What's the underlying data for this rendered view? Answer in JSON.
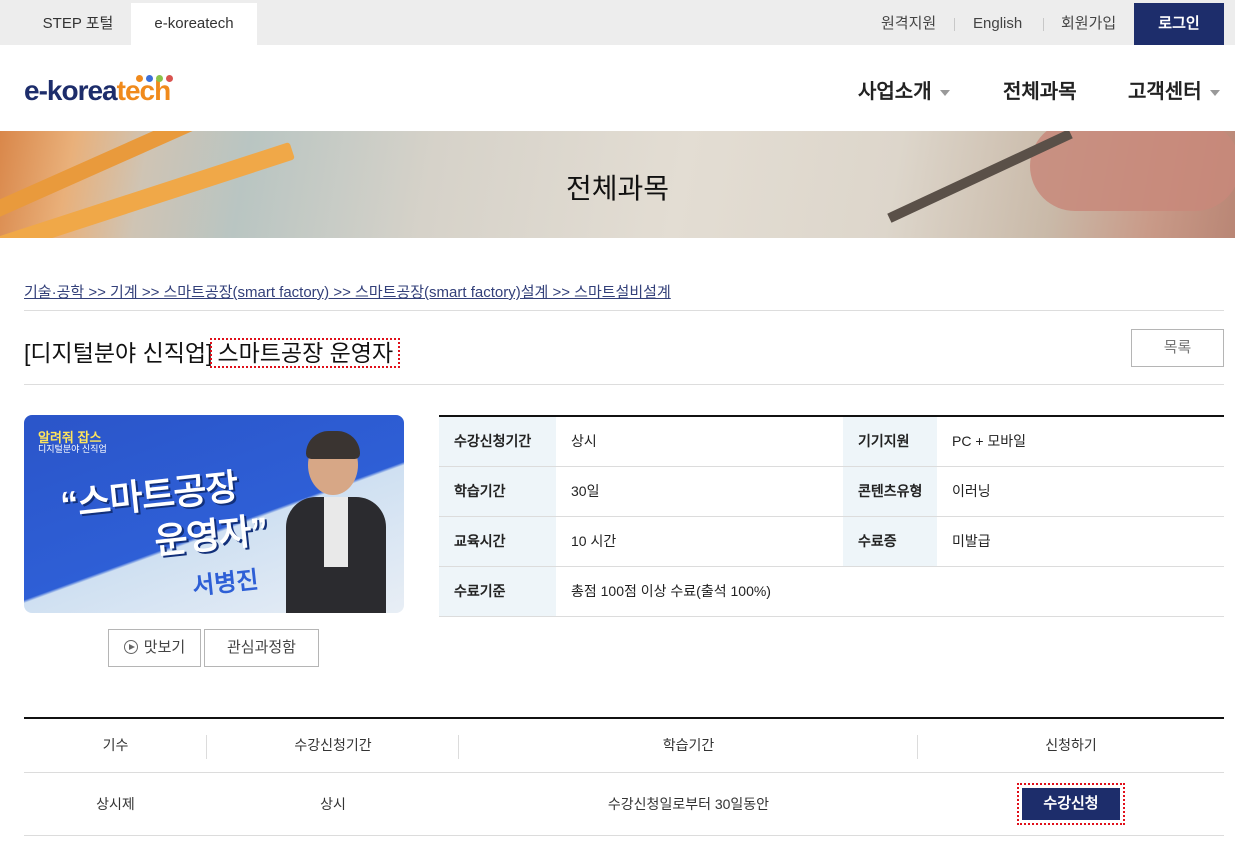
{
  "topbar": {
    "tabs": [
      {
        "label": "STEP 포털"
      },
      {
        "label": "e-koreatech"
      }
    ],
    "utils": {
      "remote": "원격지원",
      "english": "English",
      "join": "회원가입",
      "login": "로그인"
    }
  },
  "header": {
    "logo_main": "e-korea",
    "logo_accent": "tech",
    "logo_dot_colors": [
      "#f08a1c",
      "#3c6fd8",
      "#8bc34a",
      "#d9534f"
    ],
    "gnb": [
      {
        "label": "사업소개"
      },
      {
        "label": "전체과목"
      },
      {
        "label": "고객센터"
      }
    ]
  },
  "hero": {
    "title": "전체과목"
  },
  "breadcrumb": "기술·공학 >> 기계 >> 스마트공장(smart factory) >> 스마트공장(smart factory)설계 >> 스마트설비설계",
  "course": {
    "prefix": "[디지털분야 신직업]",
    "name": "스마트공장 운영자",
    "list_button": "목록"
  },
  "thumbnail": {
    "brand": "알려줘 잡스",
    "sub": "디지털분야 신직업",
    "title_line1": "“스마트공장",
    "title_line2": "운영자”",
    "instructor": "서병진"
  },
  "thumb_buttons": {
    "preview": "맛보기",
    "wish": "관심과정함"
  },
  "info": {
    "rows": [
      {
        "k1": "수강신청기간",
        "v1": "상시",
        "k2": "기기지원",
        "v2": "PC + 모바일"
      },
      {
        "k1": "학습기간",
        "v1": "30일",
        "k2": "콘텐츠유형",
        "v2": "이러닝"
      },
      {
        "k1": "교육시간",
        "v1": "10 시간",
        "k2": "수료증",
        "v2": "미발급"
      },
      {
        "k1": "수료기준",
        "v1": "총점 100점 이상 수료(출석 100%)"
      }
    ]
  },
  "enroll": {
    "headers": [
      "기수",
      "수강신청기간",
      "학습기간",
      "신청하기"
    ],
    "row": {
      "term": "상시제",
      "period": "상시",
      "study": "수강신청일로부터 30일동안"
    },
    "button": "수강신청"
  }
}
